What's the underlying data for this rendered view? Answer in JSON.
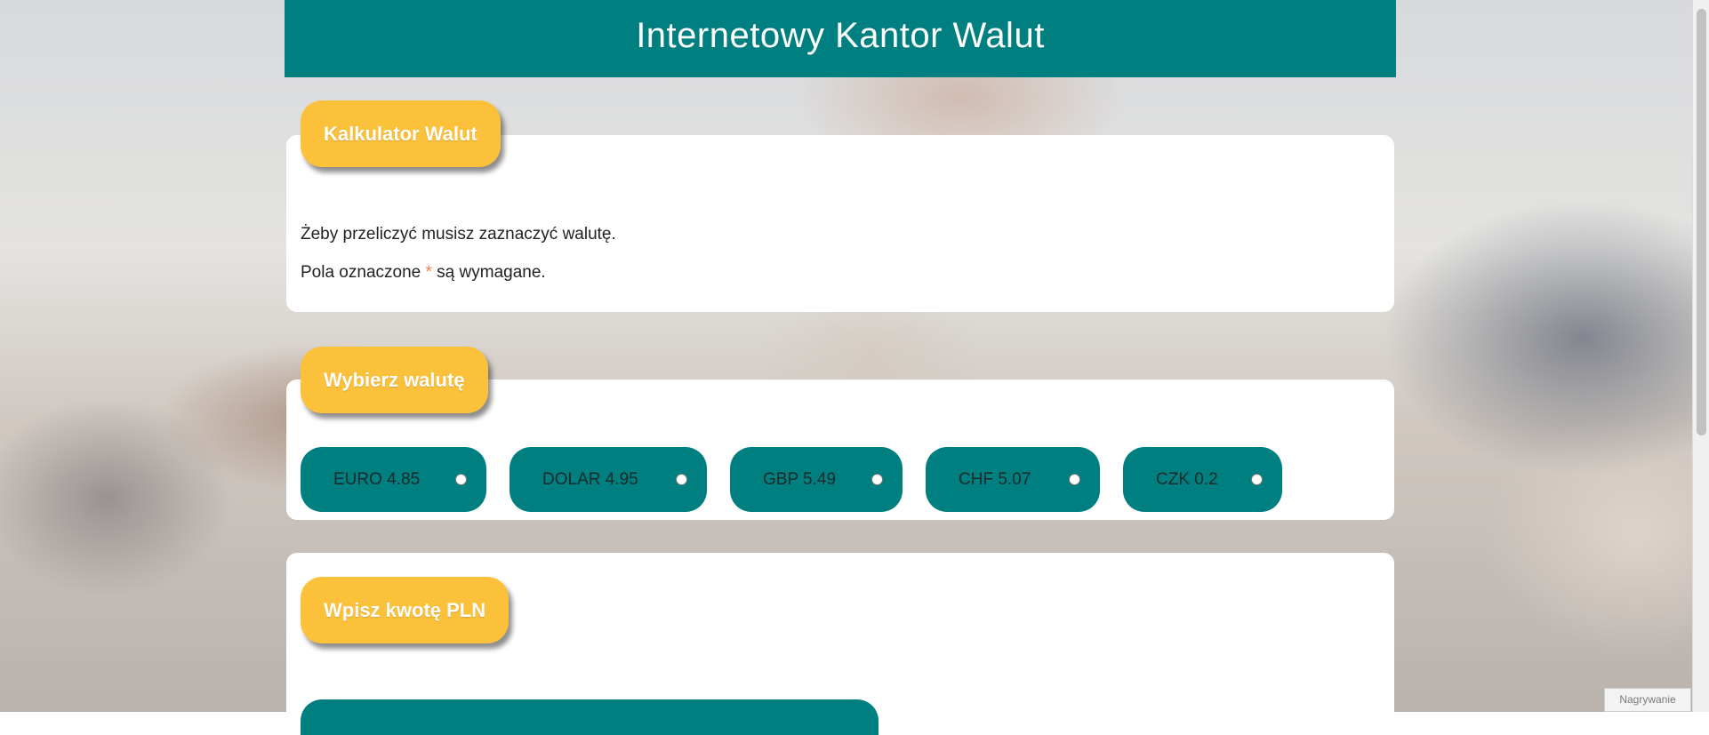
{
  "header": {
    "title": "Internetowy Kantor Walut"
  },
  "calculator": {
    "heading": "Kalkulator Walut",
    "note_select": "Żeby przeliczyć musisz zaznaczyć walutę.",
    "note_required_prefix": "Pola oznaczone ",
    "note_required_star": "*",
    "note_required_suffix": " są wymagane."
  },
  "currency_section": {
    "heading": "Wybierz walutę",
    "options": [
      {
        "label": "EURO 4.85"
      },
      {
        "label": "DOLAR 4.95"
      },
      {
        "label": "GBP 5.49"
      },
      {
        "label": "CHF 5.07"
      },
      {
        "label": "CZK 0.2"
      }
    ]
  },
  "amount_section": {
    "heading": "Wpisz kwotę PLN"
  },
  "overlay": {
    "recording_label": "Nagrywanie"
  },
  "colors": {
    "primary": "#007f80",
    "accent": "#fcc13a",
    "required_star": "#ff7a45"
  }
}
